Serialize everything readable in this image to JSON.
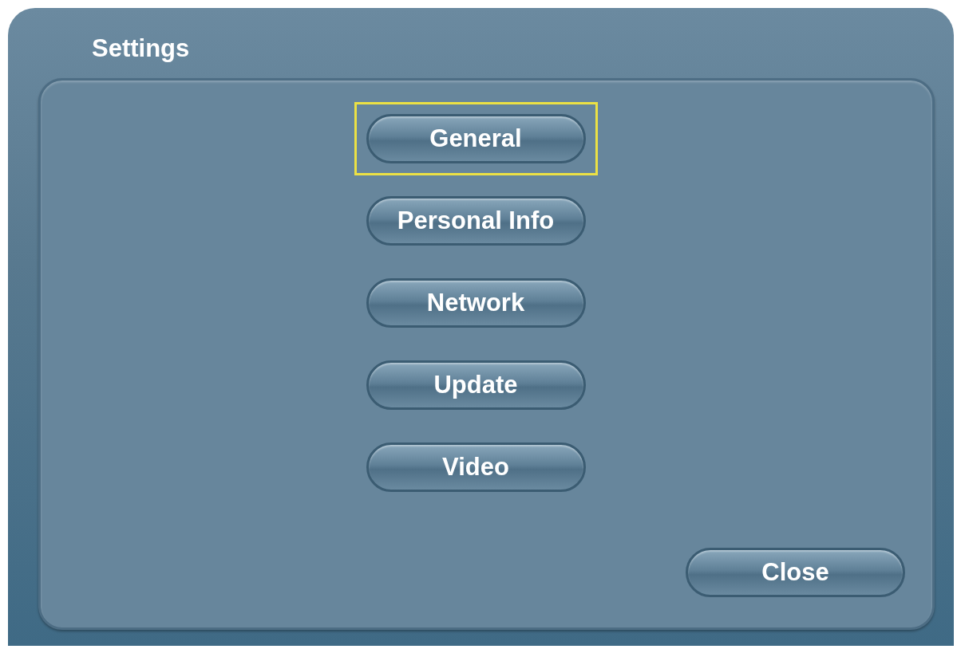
{
  "window": {
    "title": "Settings"
  },
  "menu": [
    {
      "label": "General",
      "selected": true
    },
    {
      "label": "Personal Info",
      "selected": false
    },
    {
      "label": "Network",
      "selected": false
    },
    {
      "label": "Update",
      "selected": false
    },
    {
      "label": "Video",
      "selected": false
    }
  ],
  "buttons": [
    {
      "label": "Close"
    }
  ]
}
